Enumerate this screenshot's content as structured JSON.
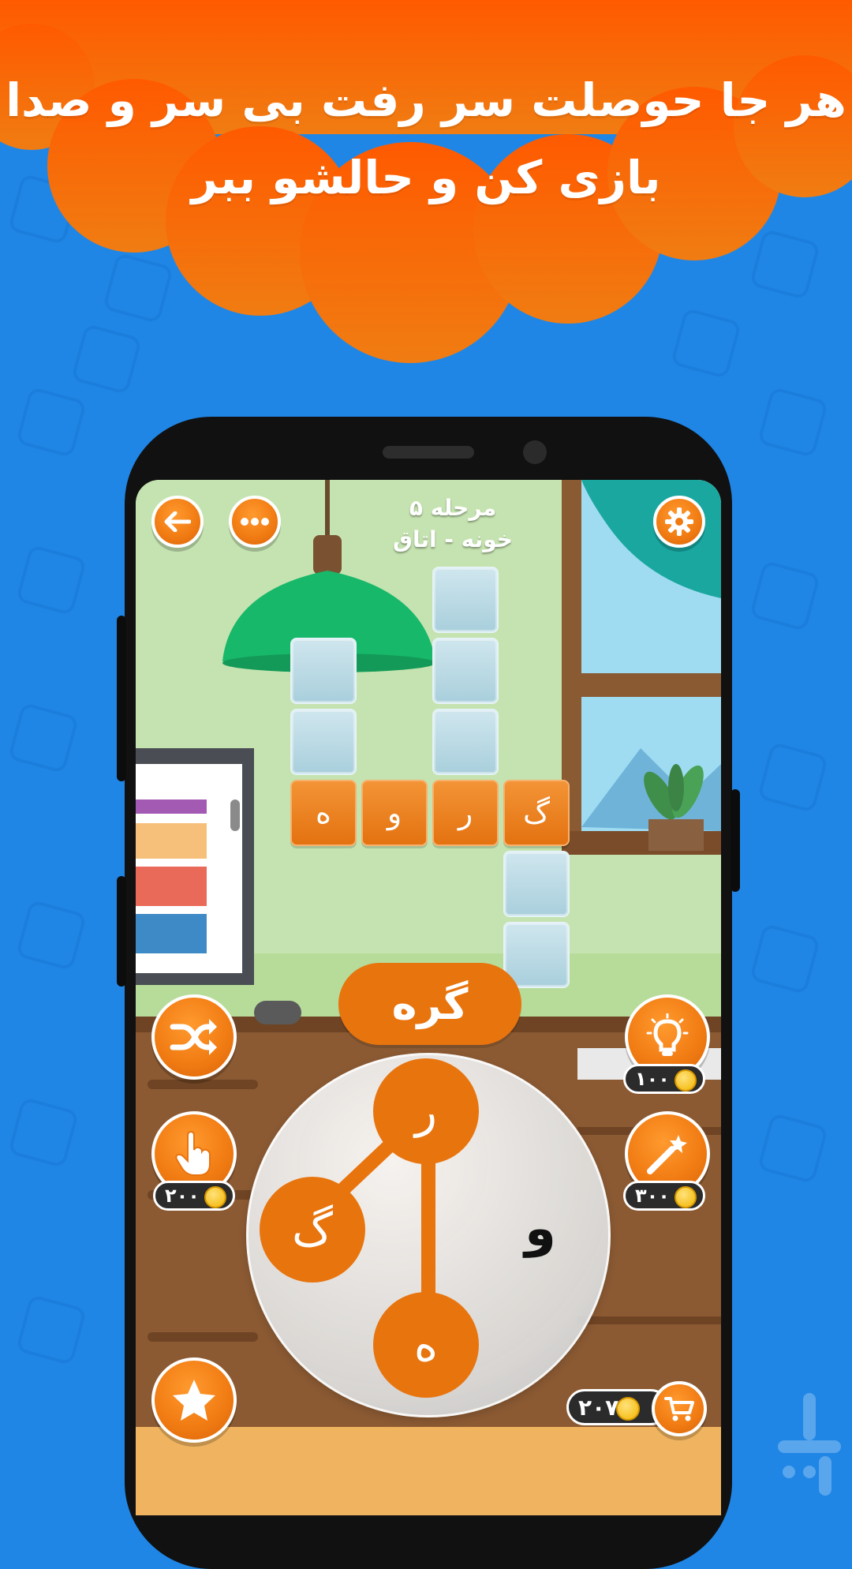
{
  "banner": {
    "line1": "هر جا حوصلت سر رفت بی سر و صدا",
    "line2": "بازی کن و حالشو ببر"
  },
  "level": {
    "title": "مرحله ۵",
    "subtitle": "خونه - اتاق"
  },
  "crossword": {
    "filled_letters": [
      "ه",
      "و",
      "ر",
      "گ"
    ]
  },
  "current_word": "گره",
  "wheel_letters": {
    "top": "ر",
    "left": "گ",
    "right": "و",
    "bottom": "ه"
  },
  "powerups": {
    "hint_cost": "۱۰۰",
    "finger_cost": "۲۰۰",
    "wand_cost": "۳۰۰"
  },
  "coins": {
    "balance": "۲۰۷"
  },
  "icons": {
    "back": "arrow-left-icon",
    "more": "more-dots-icon",
    "settings": "gear-icon",
    "shuffle": "shuffle-icon",
    "hint": "lightbulb-icon",
    "finger": "pointing-hand-icon",
    "wand": "magic-wand-icon",
    "star": "star-icon",
    "cart": "cart-icon"
  },
  "colors": {
    "accent_orange": "#e8740e",
    "background_blue": "#1f86e6"
  }
}
